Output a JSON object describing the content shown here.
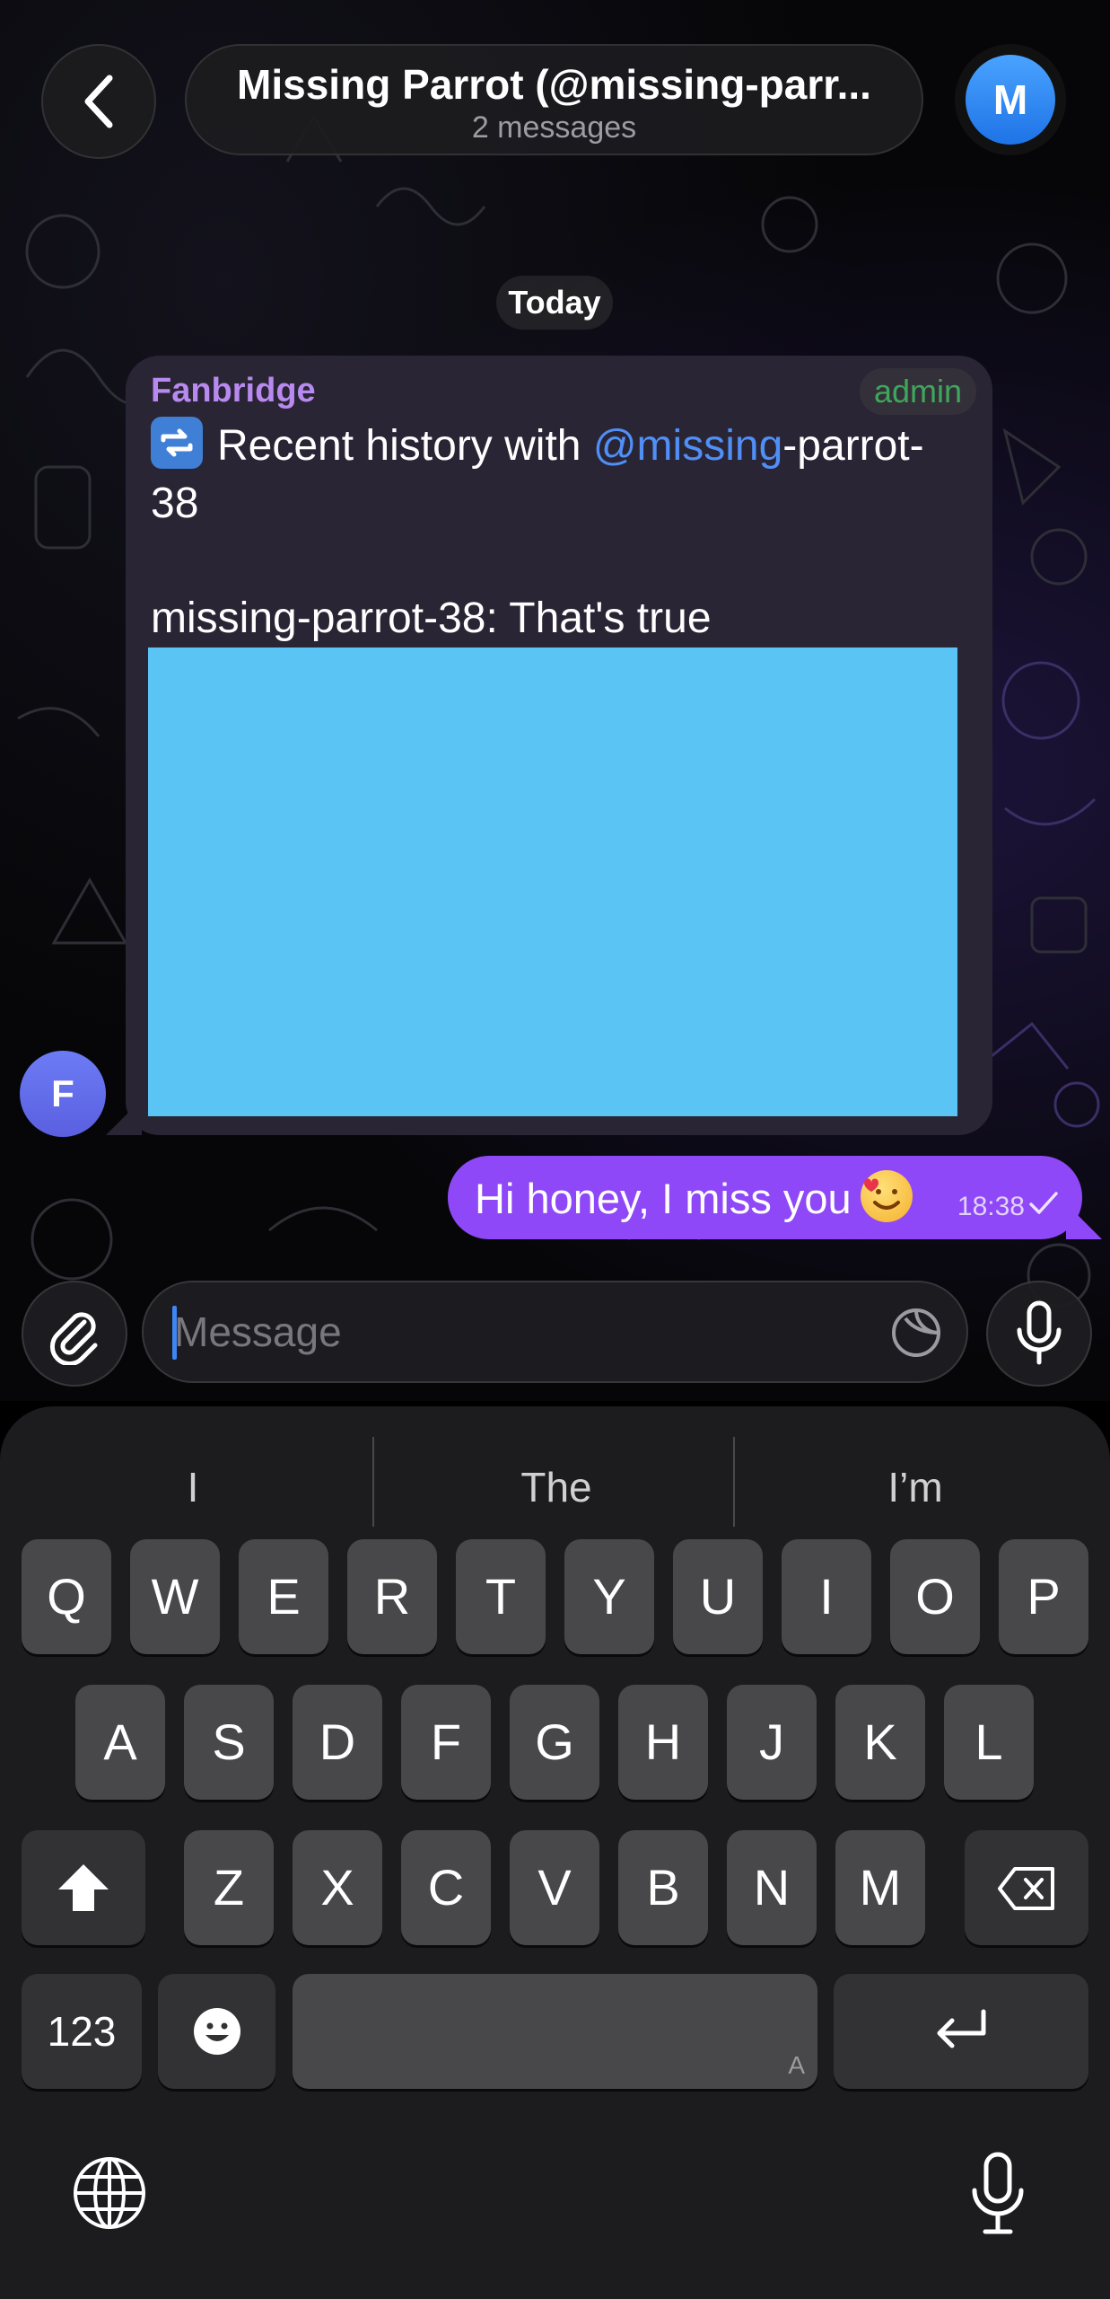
{
  "header": {
    "title": "Missing Parrot (@missing-parr...",
    "subtitle": "2 messages",
    "avatar_letter": "M"
  },
  "date_separator": "Today",
  "messages": [
    {
      "sender": "Fanbridge",
      "role_badge": "admin",
      "text_prefix": "Recent history with ",
      "mention": "@missing",
      "text_after_mention": "-parrot-38",
      "quote": "missing-parrot-38: That's true",
      "avatar_letter": "F"
    },
    {
      "text": "Hi honey, I miss you",
      "time": "18:38"
    }
  ],
  "composer": {
    "placeholder": "Message"
  },
  "keyboard": {
    "suggestions": [
      "I",
      "The",
      "I’m"
    ],
    "row1": [
      "Q",
      "W",
      "E",
      "R",
      "T",
      "Y",
      "U",
      "I",
      "O",
      "P"
    ],
    "row2": [
      "A",
      "S",
      "D",
      "F",
      "G",
      "H",
      "J",
      "K",
      "L"
    ],
    "row3": [
      "Z",
      "X",
      "C",
      "V",
      "B",
      "N",
      "M"
    ],
    "numbers_key": "123",
    "space_corner": "A"
  },
  "colors": {
    "accent": "#8e48f7",
    "sender_name": "#b88af0",
    "admin_badge": "#3fa75b",
    "mention": "#4f8ff6",
    "media": "#5ac4f5"
  }
}
